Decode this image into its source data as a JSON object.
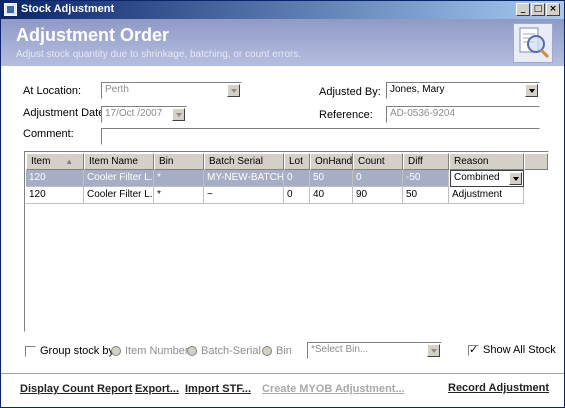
{
  "window": {
    "title": "Stock Adjustment",
    "controls": {
      "minimize": "_",
      "maximize": "□",
      "close": "×"
    }
  },
  "header": {
    "title": "Adjustment Order",
    "subtitle": "Adjust stock quantity due to shrinkage, batching, or count errors.",
    "icon": "magnifier-document-icon"
  },
  "form": {
    "location_label": "At Location:",
    "location_value": "Perth",
    "date_label": "Adjustment Date:",
    "date_value": "17/Oct /2007",
    "adjusted_by_label": "Adjusted By:",
    "adjusted_by_value": "Jones, Mary",
    "reference_label": "Reference:",
    "reference_value": "AD-0536-9204",
    "comment_label": "Comment:",
    "comment_value": ""
  },
  "grid": {
    "columns": [
      "Item",
      "Item Name",
      "Bin",
      "Batch Serial",
      "Lot",
      "OnHand",
      "Count",
      "Diff",
      "Reason"
    ],
    "sort_indicator": "▲",
    "rows": [
      {
        "item": "120",
        "name": "Cooler Filter L...",
        "bin": "*",
        "batch": "MY-NEW-BATCH",
        "lot": "0",
        "onhand": "50",
        "count": "0",
        "diff": "-50",
        "reason": "Combined",
        "selected": true
      },
      {
        "item": "120",
        "name": "Cooler Filter L...",
        "bin": "*",
        "batch": "~",
        "lot": "0",
        "onhand": "40",
        "count": "90",
        "diff": "50",
        "reason": "Adjustment",
        "selected": false
      }
    ]
  },
  "options": {
    "group_label": "Group stock by :",
    "group_checked": false,
    "radio_item": "Item Number",
    "radio_batch": "Batch-Serial",
    "radio_bin": "Bin",
    "select_bin_placeholder": "*Select Bin...",
    "show_all_label": "Show All Stock",
    "show_all_checked": true
  },
  "footer": {
    "display_report": "Display Count Report",
    "export": "Export...",
    "import": "Import STF...",
    "create_myob": "Create MYOB Adjustment...",
    "record": "Record Adjustment"
  }
}
